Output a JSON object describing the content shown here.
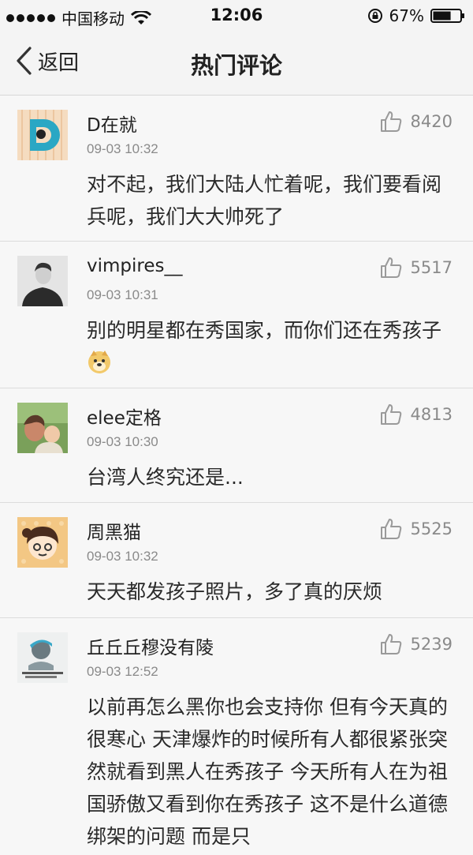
{
  "status_bar": {
    "carrier": "中国移动",
    "time": "12:06",
    "battery": "67%",
    "battery_level": 0.67
  },
  "nav": {
    "back_label": "返回",
    "title": "热门评论"
  },
  "comments": [
    {
      "user": "D在就",
      "time": "09-03 10:32",
      "likes": "8420",
      "text": "对不起，我们大陆人忙着呢，我们要看阅兵呢，我们大大帅死了"
    },
    {
      "user": "vimpires__",
      "time": "09-03 10:31",
      "likes": "5517",
      "text": "别的明星都在秀国家，而你们还在秀孩子",
      "emoji": "doge-emoji"
    },
    {
      "user": "elee定格",
      "time": "09-03 10:30",
      "likes": "4813",
      "text": "台湾人终究还是..."
    },
    {
      "user": "周黑猫",
      "time": "09-03 10:32",
      "likes": "5525",
      "text": "天天都发孩子照片，多了真的厌烦"
    },
    {
      "user": "丘丘丘穆没有陵",
      "time": "09-03 12:52",
      "likes": "5239",
      "text": "以前再怎么黑你也会支持你 但有今天真的很寒心 天津爆炸的时候所有人都很紧张突然就看到黑人在秀孩子 今天所有人在为祖国骄傲又看到你在秀孩子 这不是什么道德绑架的问题 而是只"
    }
  ],
  "icons": {
    "back": "chevron-left-icon",
    "like": "thumbs-up-icon",
    "signal": "signal-dots-icon",
    "wifi": "wifi-icon",
    "lock": "rotation-lock-icon",
    "battery": "battery-icon"
  }
}
